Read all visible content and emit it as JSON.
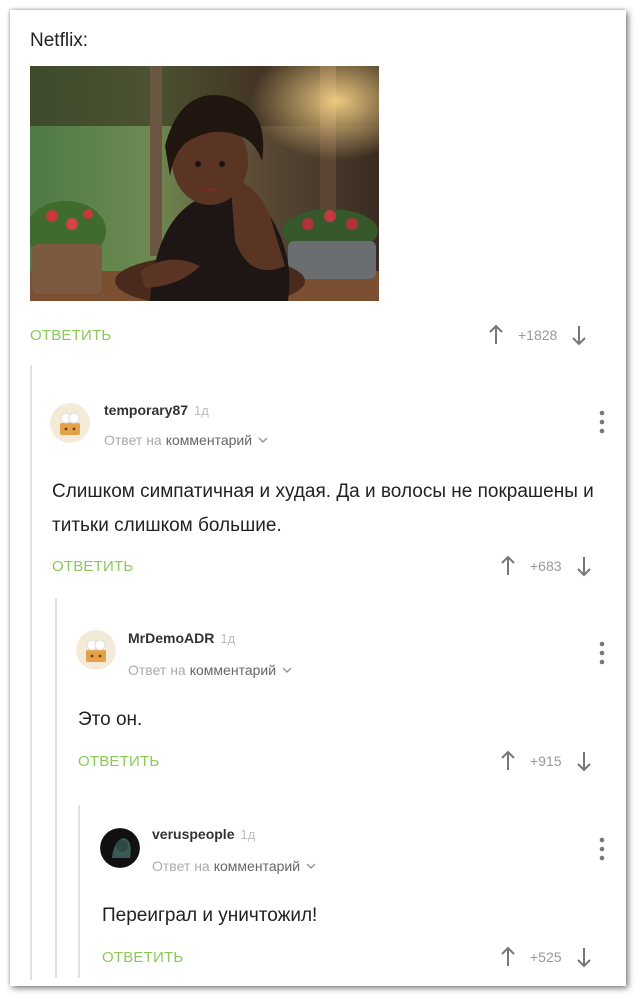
{
  "post": {
    "author_label": "Netflix:",
    "reply_label": "ОТВЕТИТЬ",
    "score": "+1828"
  },
  "comments": [
    {
      "username": "temporary87",
      "time": "1д",
      "reply_prefix": "Ответ на",
      "reply_link": "комментарий",
      "text": "Слишком симпатичная и худая. Да и волосы не покрашены и титьки слишком большие.",
      "reply_label": "ОТВЕТИТЬ",
      "score": "+683"
    },
    {
      "username": "MrDemoADR",
      "time": "1д",
      "reply_prefix": "Ответ на",
      "reply_link": "комментарий",
      "text": "Это он.",
      "reply_label": "ОТВЕТИТЬ",
      "score": "+915"
    },
    {
      "username": "veruspeople",
      "time": "1д",
      "reply_prefix": "Ответ на",
      "reply_link": "комментарий",
      "text": "Переиграл и уничтожил!",
      "reply_label": "ОТВЕТИТЬ",
      "score": "+525"
    }
  ],
  "colors": {
    "reply_green": "#8ac858",
    "muted": "#9a9a9a",
    "thread_line": "#e2e2e2"
  },
  "icons": [
    "arrow-up-icon",
    "arrow-down-icon",
    "kebab-menu-icon",
    "chevron-down-icon",
    "avatar-chef-icon",
    "avatar-dark-icon"
  ]
}
